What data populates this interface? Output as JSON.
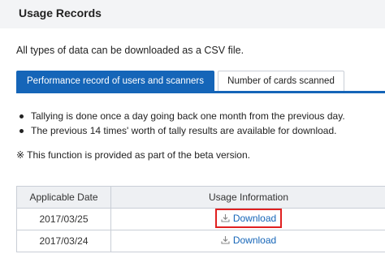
{
  "header": {
    "title": "Usage Records"
  },
  "intro": "All types of data can be downloaded as a CSV file.",
  "tabs": [
    {
      "label": "Performance record of users and scanners",
      "active": true
    },
    {
      "label": "Number of cards scanned",
      "active": false
    }
  ],
  "notes": [
    "Tallying is done once a day going back one month from the previous day.",
    "The previous 14 times' worth of tally results are available for download."
  ],
  "beta_note": "※ This function is provided as part of the beta version.",
  "table": {
    "headers": [
      "Applicable Date",
      "Usage Information"
    ],
    "rows": [
      {
        "date": "2017/03/25",
        "action": "Download",
        "highlighted": true
      },
      {
        "date": "2017/03/24",
        "action": "Download",
        "highlighted": false
      }
    ]
  },
  "colors": {
    "accent": "#1565b8",
    "highlight": "#e02020",
    "header_bg": "#f3f4f6"
  },
  "icons": {
    "download": "download-icon"
  }
}
